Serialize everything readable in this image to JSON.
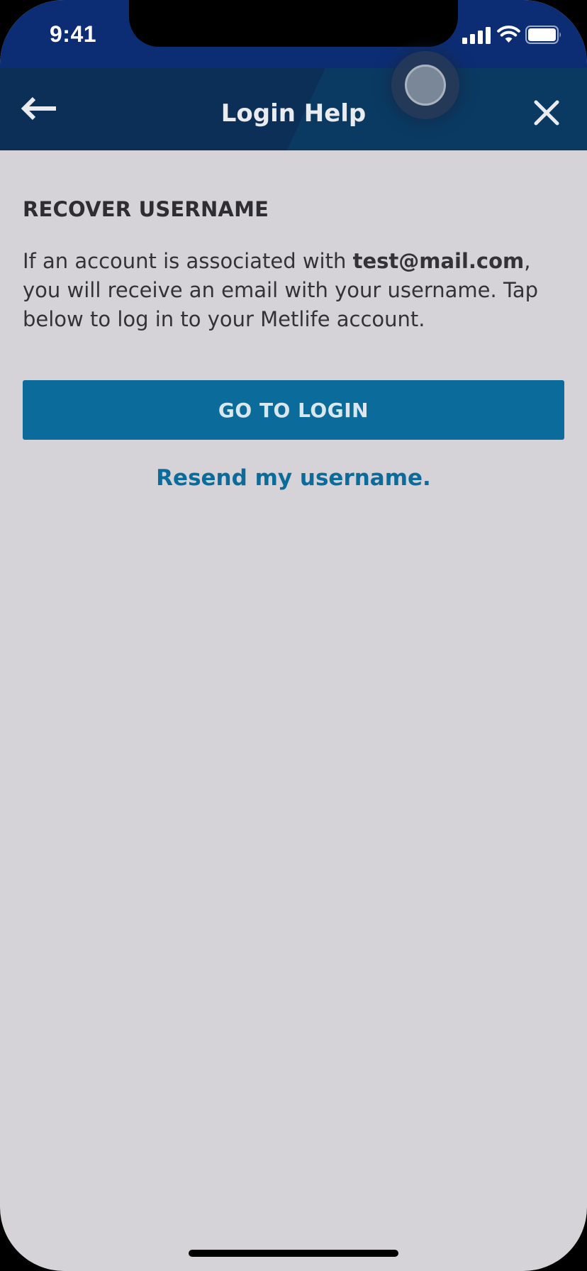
{
  "status_bar": {
    "time": "9:41",
    "icons": [
      "signal-icon",
      "wifi-icon",
      "battery-icon"
    ]
  },
  "header": {
    "title": "Login Help",
    "back_icon": "arrow-left-icon",
    "close_icon": "close-icon"
  },
  "content": {
    "heading": "RECOVER USERNAME",
    "message_prefix": "If an account is associated with ",
    "email": "test@mail.com",
    "message_suffix": ", you will receive an email with your username. Tap below to log in to your Metlife account.",
    "primary_button": "GO TO LOGIN",
    "resend_link": "Resend my username."
  },
  "colors": {
    "status_bar": "#0c2d74",
    "header": "#0b2f56",
    "background": "#d5d3d7",
    "accent": "#0b6b9a",
    "text": "#333236"
  }
}
